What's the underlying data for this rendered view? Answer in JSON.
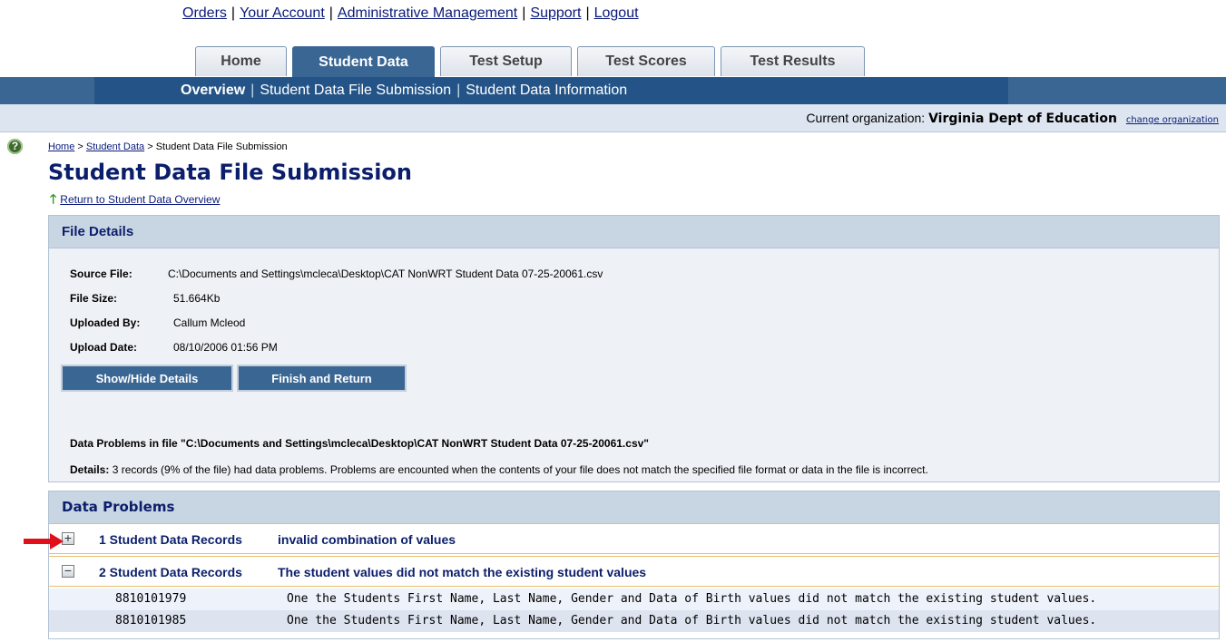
{
  "top_links": [
    "Orders",
    "Your Account",
    "Administrative Management",
    "Support",
    "Logout"
  ],
  "tabs": [
    {
      "label": "Home",
      "active": false
    },
    {
      "label": "Student Data",
      "active": true
    },
    {
      "label": "Test Setup",
      "active": false
    },
    {
      "label": "Test Scores",
      "active": false
    },
    {
      "label": "Test Results",
      "active": false
    }
  ],
  "subnav": {
    "overview": "Overview",
    "file_submission": "Student Data File Submission",
    "information": "Student Data Information"
  },
  "org": {
    "label": "Current organization:",
    "name": "Virginia Dept of Education",
    "change_link": "change organization"
  },
  "breadcrumb": {
    "home": "Home",
    "sep": ">",
    "student_data": "Student Data",
    "current": "Student Data File Submission"
  },
  "page_title": "Student Data File Submission",
  "return_link": "Return to Student Data Overview",
  "file_details": {
    "heading": "File Details",
    "rows": [
      {
        "label": "Source File:",
        "value": "C:\\Documents and Settings\\mcleca\\Desktop\\CAT NonWRT Student Data 07-25-20061.csv"
      },
      {
        "label": "File Size:",
        "value": "51.664Kb"
      },
      {
        "label": "Uploaded By:",
        "value": "Callum Mcleod"
      },
      {
        "label": "Upload Date:",
        "value": "08/10/2006 01:56 PM"
      }
    ],
    "buttons": {
      "show_hide": "Show/Hide Details",
      "finish": "Finish and Return"
    },
    "problems_title": "Data Problems in file \"C:\\Documents and Settings\\mcleca\\Desktop\\CAT NonWRT Student Data 07-25-20061.csv\"",
    "details_label": "Details:",
    "details_text": "3 records (9% of the file) had data problems. Problems are encounted when the contents of your file does not match the specified file format or data in the file is incorrect."
  },
  "data_problems": {
    "heading": "Data Problems",
    "groups": [
      {
        "toggle": "+",
        "count": "1 Student Data Records",
        "message": "invalid combination of values",
        "expanded": false
      },
      {
        "toggle": "−",
        "count": "2 Student Data Records",
        "message": "The student values did not match the existing student values",
        "expanded": true
      }
    ],
    "records": [
      {
        "id": "8810101979",
        "description": "One the Students First Name, Last Name, Gender and Data of Birth values did not match the existing student values."
      },
      {
        "id": "8810101985",
        "description": "One the Students First Name, Last Name, Gender and Data of Birth values did not match the existing student values."
      }
    ]
  },
  "colors": {
    "nav_blue": "#3a6694",
    "title_navy": "#0b1e6b",
    "row_alt": "#dde3ef",
    "annotation_red": "#e0101a"
  },
  "icons": {
    "help": "help-circle-icon",
    "return": "green-up-arrow-icon",
    "annotation": "red-pointer-arrow-icon"
  }
}
